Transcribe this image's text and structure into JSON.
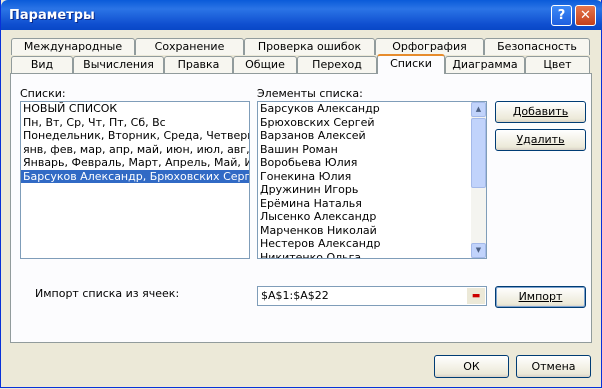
{
  "window": {
    "title": "Параметры",
    "help": "?",
    "close": "✕"
  },
  "tabs_back": [
    "Международные",
    "Сохранение",
    "Проверка ошибок",
    "Орфография",
    "Безопасность"
  ],
  "tabs_front": [
    "Вид",
    "Вычисления",
    "Правка",
    "Общие",
    "Переход",
    "Списки",
    "Диаграмма",
    "Цвет"
  ],
  "lists": {
    "label": "Списки:",
    "items": [
      "НОВЫЙ СПИСОК",
      "Пн, Вт, Ср, Чт, Пт, Сб, Вс",
      "Понедельник, Вторник, Среда, Четверг,",
      "янв, фев, мар, апр, май, июн, июл, авг,",
      "Январь, Февраль, Март, Апрель, Май, И",
      "Барсуков Александр, Брюховских Серге"
    ],
    "selected_index": 5
  },
  "elements": {
    "label": "Элементы списка:",
    "items": [
      "Барсуков Александр",
      "Брюховских Сергей",
      "Варзанов Алексей",
      "Вашин Роман",
      "Воробьева Юлия",
      "Гонекина Юлия",
      "Дружинин Игорь",
      "Ерёмина Наталья",
      "Лысенко Александр",
      "Марченков Николай",
      "Нестеров Александр",
      "Никитенко Ольга"
    ]
  },
  "buttons": {
    "add": "Добавить",
    "delete": "Удалить",
    "import": "Импорт",
    "ok": "ОК",
    "cancel": "Отмена"
  },
  "import": {
    "label": "Импорт списка из ячеек:",
    "value": "$A$1:$A$22"
  }
}
